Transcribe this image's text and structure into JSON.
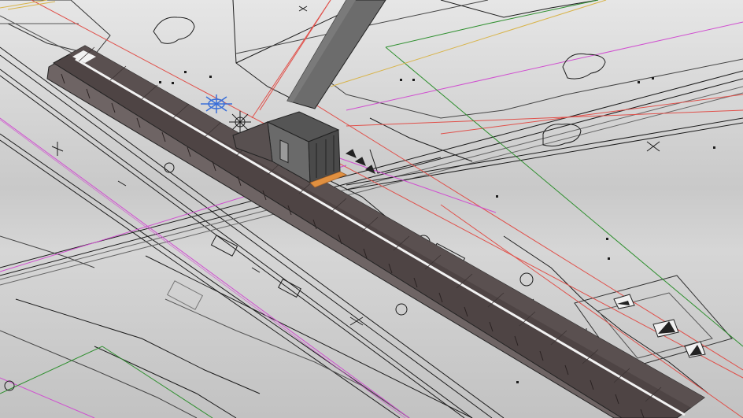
{
  "viewport": {
    "view_mode": "3D perspective",
    "background_gradient": [
      "#e6e6e6",
      "#c6c6c6",
      "#d8d8d8",
      "#bfbfbf"
    ]
  },
  "colors": {
    "linework": "#1c1c1c",
    "linework_light": "#5a5a5a",
    "red_line": "#e0504a",
    "magenta_line": "#d04fd0",
    "green_line": "#2e8f2e",
    "yellow_line": "#d8b44a",
    "blue_symbol": "#3a6fd8",
    "roof_dark": "#4e4444",
    "roof_mid": "#5e5454",
    "roof_side": "#6e6464",
    "roof_stripe": "#f2f2f2",
    "bridge_grey": "#6c6c6c",
    "orange_base": "#e09040"
  },
  "model_elements": [
    {
      "name": "platform-canopy",
      "kind": "canopy"
    },
    {
      "name": "footbridge-tower",
      "kind": "structure"
    },
    {
      "name": "footbridge-deck",
      "kind": "structure"
    },
    {
      "name": "railway-track",
      "kind": "linework"
    },
    {
      "name": "property-boundary",
      "kind": "linework"
    },
    {
      "name": "tree-symbol",
      "kind": "symbol"
    },
    {
      "name": "electric-pylon-marker",
      "kind": "symbol"
    }
  ]
}
